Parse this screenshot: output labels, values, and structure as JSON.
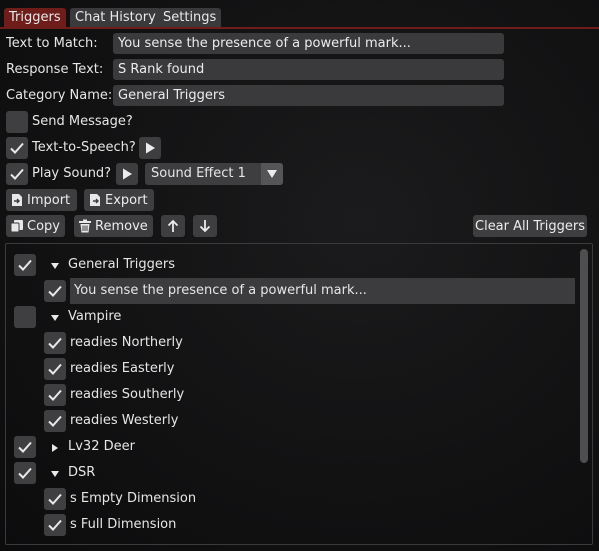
{
  "tabs": [
    {
      "label": "Triggers",
      "active": true
    },
    {
      "label": "Chat History",
      "active": false
    },
    {
      "label": "Settings",
      "active": false
    }
  ],
  "form": {
    "text_to_match_label": "Text to Match:",
    "text_to_match_value": "You sense the presence of a powerful mark...",
    "response_text_label": "Response Text:",
    "response_text_value": "S Rank found",
    "category_name_label": "Category Name:",
    "category_name_value": "General Triggers"
  },
  "options": {
    "send_message_label": "Send Message?",
    "send_message_checked": false,
    "tts_label": "Text-to-Speech?",
    "tts_checked": true,
    "play_sound_label": "Play Sound?",
    "play_sound_checked": true,
    "sound_select_value": "Sound Effect 1"
  },
  "toolbar": {
    "import_label": "Import",
    "export_label": "Export",
    "copy_label": "Copy",
    "remove_label": "Remove",
    "clear_all_label": "Clear All Triggers"
  },
  "tree": [
    {
      "label": "General Triggers",
      "checked": true,
      "level": 0,
      "expanded": true,
      "type": "category"
    },
    {
      "label": "You sense the presence of a powerful mark...",
      "checked": true,
      "level": 1,
      "type": "trigger",
      "selected": true
    },
    {
      "label": "Vampire",
      "checked": false,
      "level": 0,
      "expanded": true,
      "type": "category"
    },
    {
      "label": "readies Northerly",
      "checked": true,
      "level": 1,
      "type": "trigger"
    },
    {
      "label": "readies Easterly",
      "checked": true,
      "level": 1,
      "type": "trigger"
    },
    {
      "label": "readies Southerly",
      "checked": true,
      "level": 1,
      "type": "trigger"
    },
    {
      "label": "readies Westerly",
      "checked": true,
      "level": 1,
      "type": "trigger"
    },
    {
      "label": "Lv32 Deer",
      "checked": true,
      "level": 0,
      "expanded": false,
      "type": "category"
    },
    {
      "label": "DSR",
      "checked": true,
      "level": 0,
      "expanded": true,
      "type": "category"
    },
    {
      "label": "s Empty Dimension",
      "checked": true,
      "level": 1,
      "type": "trigger"
    },
    {
      "label": "s Full Dimension",
      "checked": true,
      "level": 1,
      "type": "trigger"
    }
  ],
  "colors": {
    "accent": "#6e1d1b",
    "widget": "#3a3a3c",
    "background": "#121213"
  }
}
